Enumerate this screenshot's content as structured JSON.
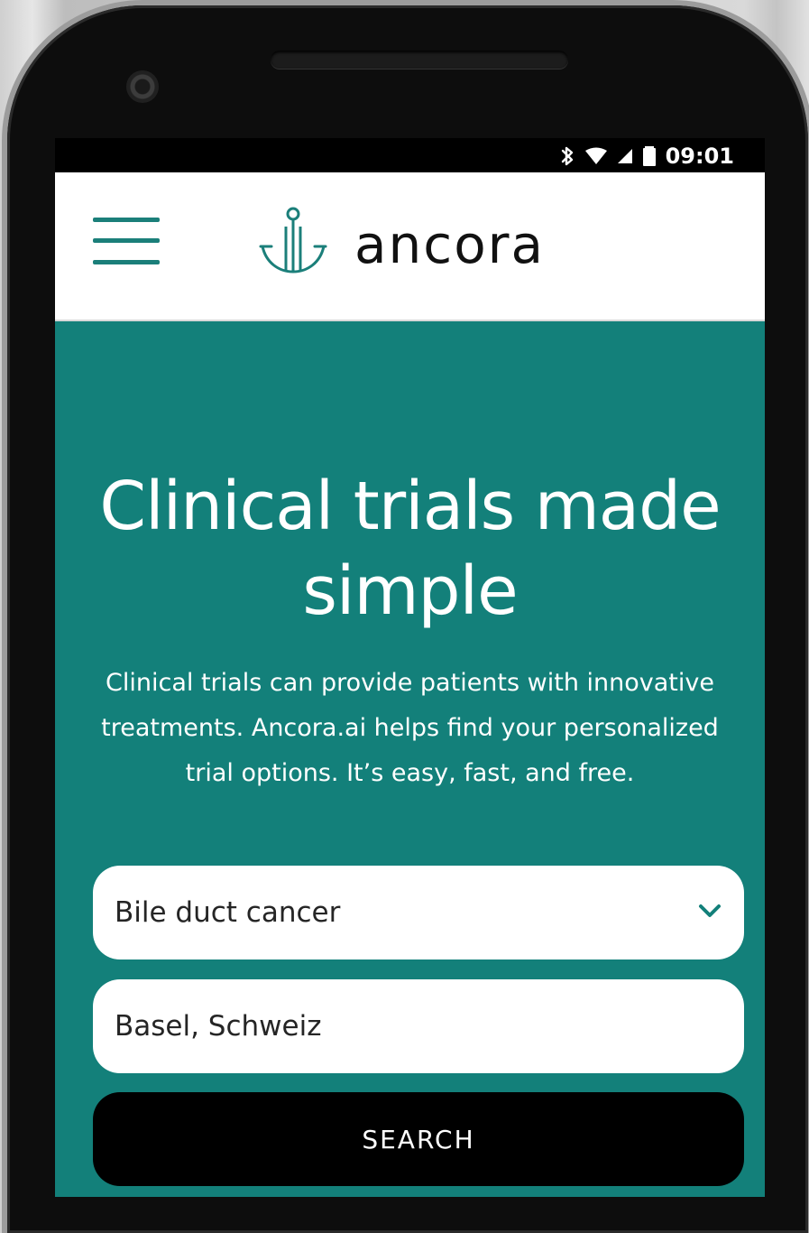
{
  "status_bar": {
    "time": "09:01",
    "icons": [
      "bluetooth-icon",
      "wifi-icon",
      "signal-icon",
      "battery-icon"
    ]
  },
  "header": {
    "brand": "ancora",
    "menu_icon": "menu-icon",
    "logo_icon": "anchor-icon",
    "accent_color": "#1b7f7a"
  },
  "hero": {
    "title": "Clinical trials made simple",
    "description": "Clinical trials can provide patients with innovative treatments. Ancora.ai helps find your personalized trial options. It’s easy, fast, and free.",
    "background_color": "#13807a"
  },
  "search_form": {
    "condition_value": "Bile duct cancer",
    "condition_icon": "chevron-down-icon",
    "location_value": "Basel, Schweiz",
    "button_label": "SEARCH"
  }
}
